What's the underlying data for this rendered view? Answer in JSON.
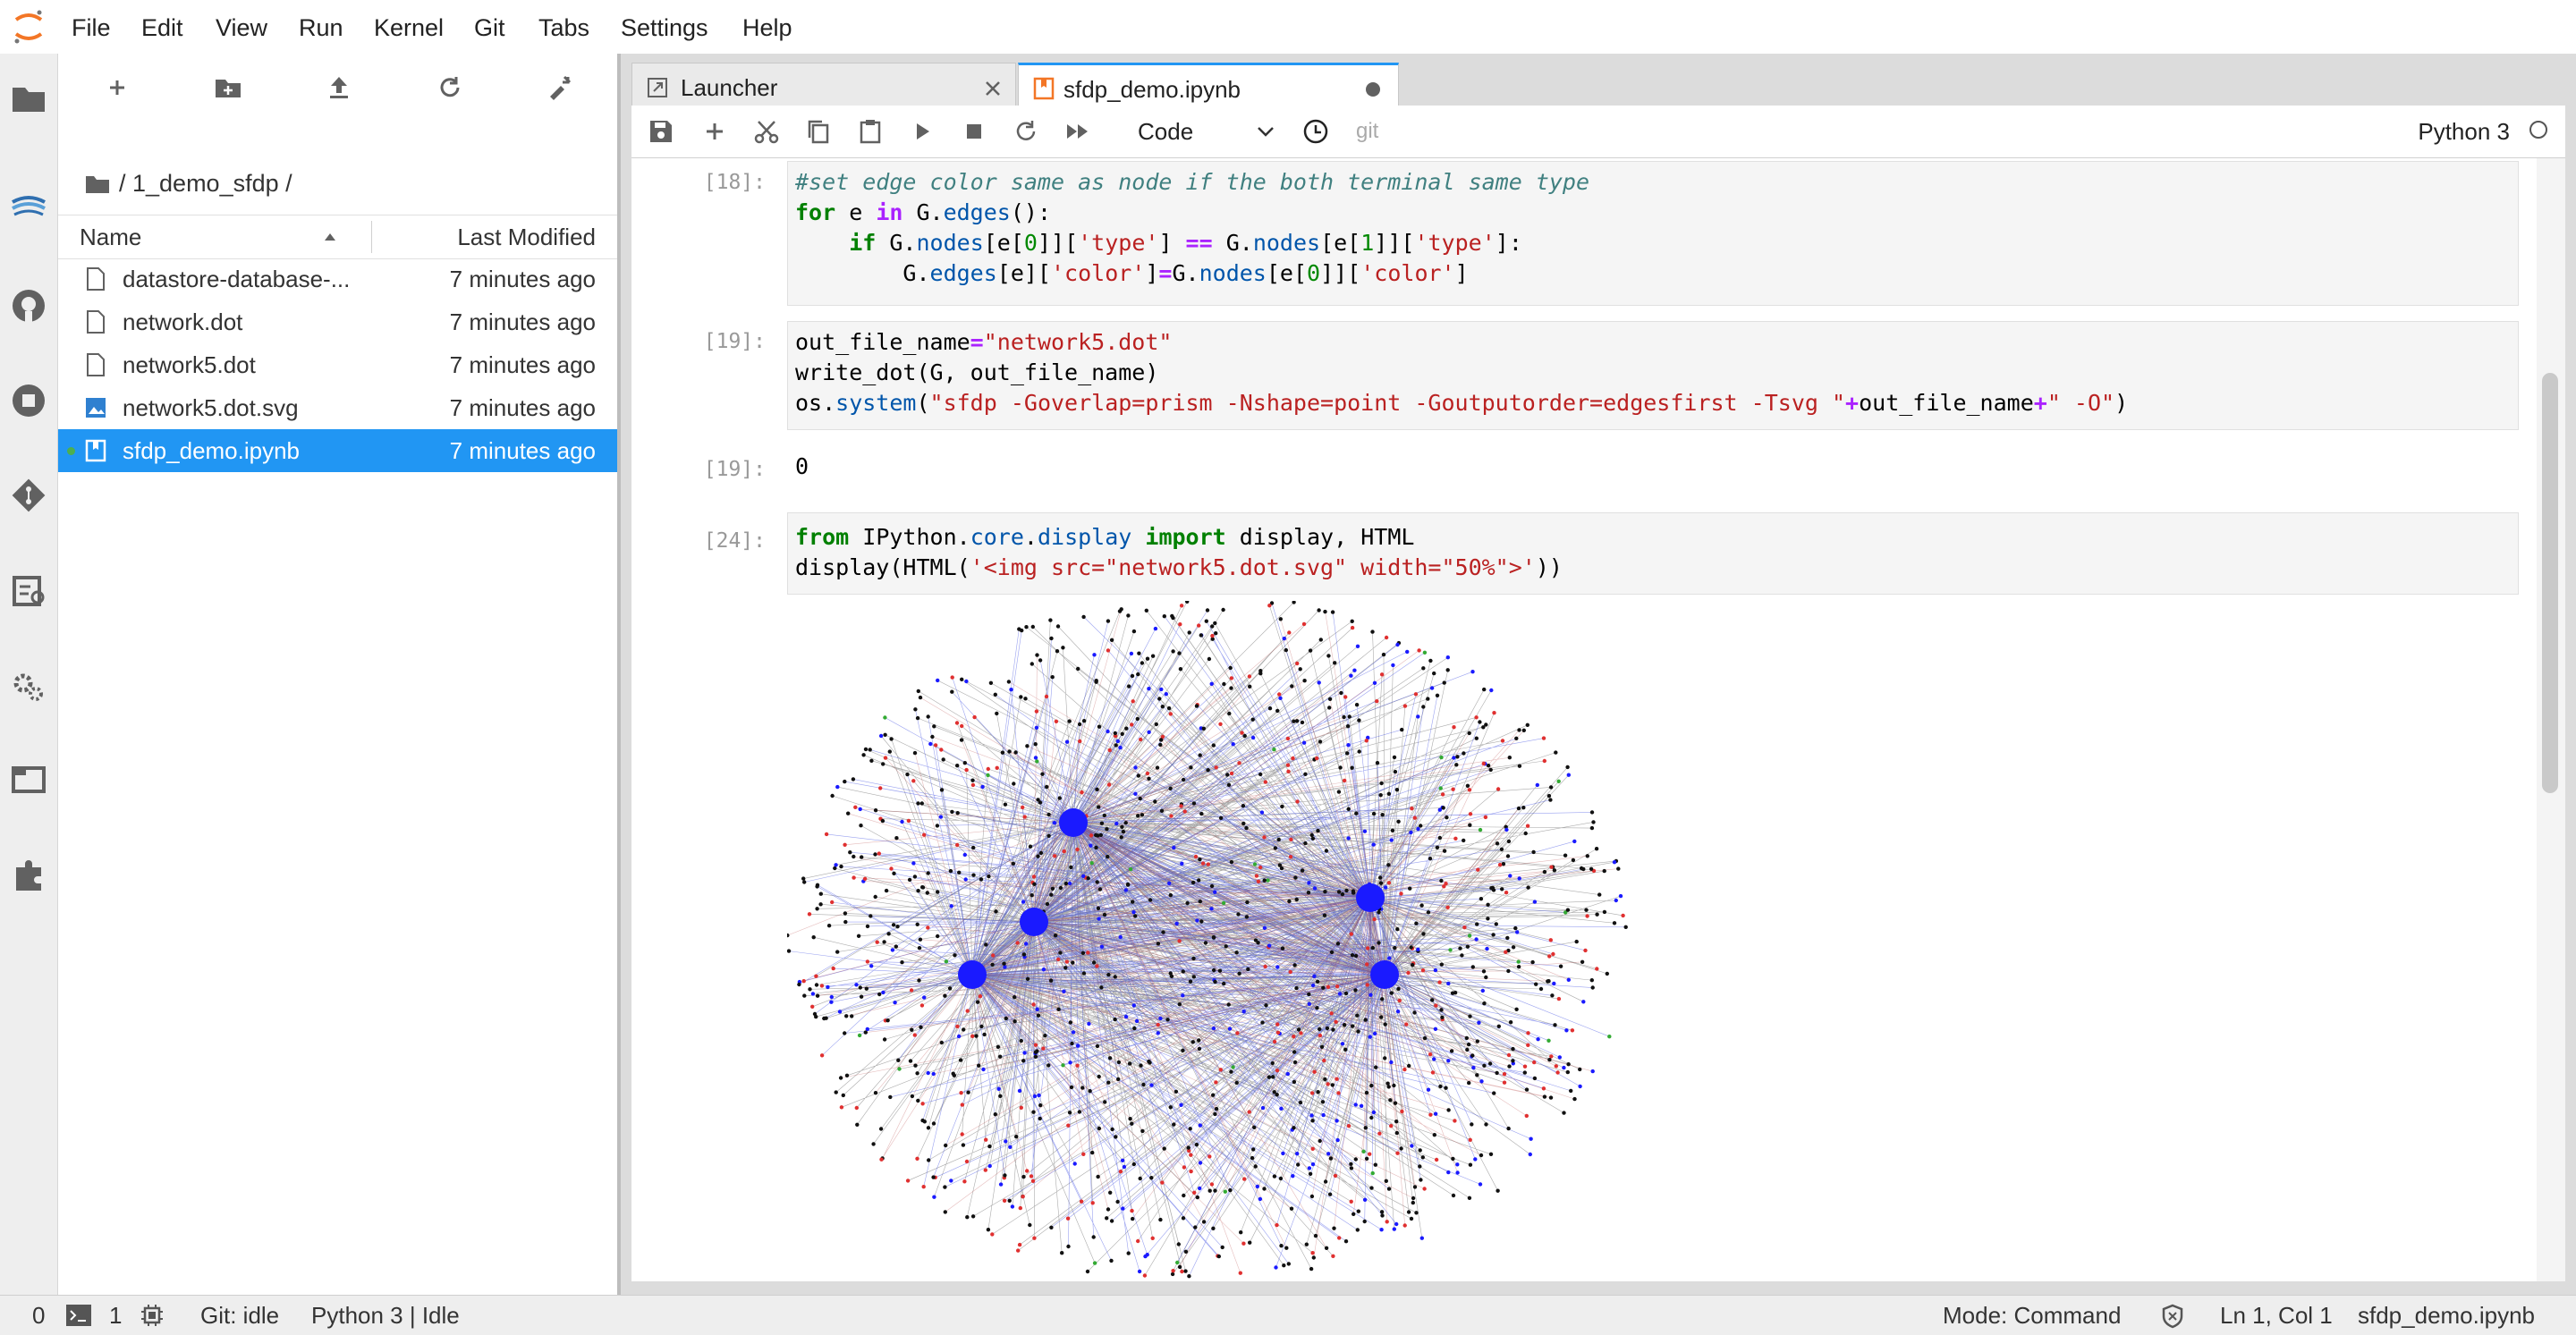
{
  "menubar": {
    "items": [
      "File",
      "Edit",
      "View",
      "Run",
      "Kernel",
      "Git",
      "Tabs",
      "Settings",
      "Help"
    ]
  },
  "filebrowser": {
    "breadcrumb": "/ 1_demo_sfdp /",
    "columns": {
      "name": "Name",
      "modified": "Last Modified"
    },
    "files": [
      {
        "name": "datastore-database-...",
        "modified": "7 minutes ago",
        "icon": "file-icon"
      },
      {
        "name": "network.dot",
        "modified": "7 minutes ago",
        "icon": "file-icon"
      },
      {
        "name": "network5.dot",
        "modified": "7 minutes ago",
        "icon": "file-icon"
      },
      {
        "name": "network5.dot.svg",
        "modified": "7 minutes ago",
        "icon": "image-file-icon"
      },
      {
        "name": "sfdp_demo.ipynb",
        "modified": "7 minutes ago",
        "icon": "notebook-icon",
        "selected": true
      }
    ]
  },
  "tabs": [
    {
      "label": "Launcher",
      "icon": "launcher-icon",
      "active": false
    },
    {
      "label": "sfdp_demo.ipynb",
      "icon": "notebook-icon",
      "active": true
    }
  ],
  "toolbar": {
    "cell_type": "Code",
    "git": "git",
    "kernel": "Python 3"
  },
  "cells": {
    "c18": {
      "prompt": "[18]:"
    },
    "c19": {
      "prompt": "[19]:",
      "out_prompt": "[19]:",
      "output": "0"
    },
    "c24": {
      "prompt": "[24]:"
    }
  },
  "statusbar": {
    "count_a": "0",
    "count_b": "1",
    "git": "Git: idle",
    "kernel": "Python 3 | Idle",
    "mode": "Mode: Command",
    "position": "Ln 1, Col 1",
    "filename": "sfdp_demo.ipynb"
  },
  "colors": {
    "accent": "#2196f3",
    "node_blue": "#1a1aff",
    "node_red": "#e03030"
  }
}
